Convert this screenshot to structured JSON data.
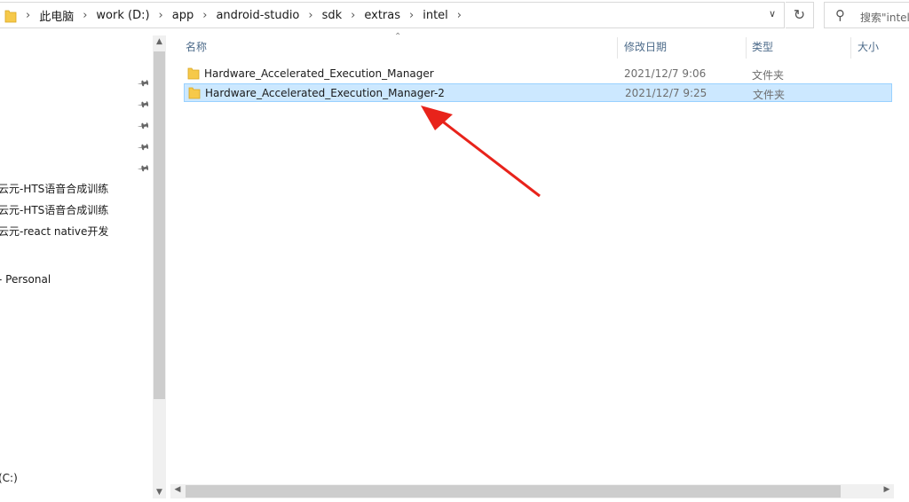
{
  "address_bar": {
    "crumbs": [
      "此电脑",
      "work (D:)",
      "app",
      "android-studio",
      "sdk",
      "extras",
      "intel"
    ],
    "separator": "›"
  },
  "search": {
    "placeholder": "搜索\"intel\""
  },
  "nav_pane": {
    "items": [
      "云元-HTS语音合成训练",
      "云元-HTS语音合成训练",
      "云元-react native开发",
      "- Personal",
      "(C:)"
    ]
  },
  "columns": {
    "name": "名称",
    "date": "修改日期",
    "type": "类型",
    "size": "大小"
  },
  "files": [
    {
      "name": "Hardware_Accelerated_Execution_Manager",
      "date": "2021/12/7 9:06",
      "type": "文件夹",
      "selected": false
    },
    {
      "name": "Hardware_Accelerated_Execution_Manager-2",
      "date": "2021/12/7 9:25",
      "type": "文件夹",
      "selected": true
    }
  ],
  "colors": {
    "selection": "#cce8ff",
    "folder": "#f6c94a",
    "arrow": "#e8231b"
  },
  "icons": {
    "folder": "folder-icon",
    "pin": "pin-icon",
    "refresh": "refresh-icon",
    "search": "search-icon"
  }
}
